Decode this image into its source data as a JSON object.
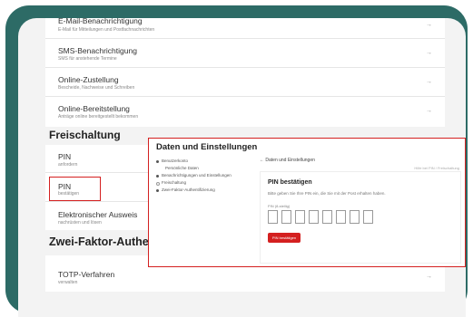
{
  "top_rows": [
    {
      "title": "E-Mail-Benachrichtigung",
      "subtitle": "E-Mail für Mitteilungen und Postfachnachrichten"
    },
    {
      "title": "SMS-Benachrichtigung",
      "subtitle": "SMS für anstehende Termine"
    },
    {
      "title": "Online-Zustellung",
      "subtitle": "Bescheide, Nachweise und Schreiben"
    },
    {
      "title": "Online-Bereitstellung",
      "subtitle": "Anträge online bereitgestellt bekommen"
    }
  ],
  "freischaltung": {
    "heading": "Freischaltung",
    "rows": [
      {
        "title": "PIN",
        "subtitle": "anfordern"
      },
      {
        "title": "PIN",
        "subtitle": "bestätigen"
      },
      {
        "title": "Elektronischer Ausweis",
        "subtitle": "nachrüsten und lösen"
      }
    ]
  },
  "zwei_faktor": {
    "heading": "Zwei-Faktor-Authentifizierung",
    "rows": [
      {
        "title": "TOTP-Verfahren",
        "subtitle": "verwalten"
      }
    ]
  },
  "arrow_glyph": "→",
  "overlay": {
    "title": "Daten und Einstellungen",
    "sidebar": [
      {
        "label": "Benutzerkonto",
        "marker": "dot"
      },
      {
        "label": "Persönliche Daten",
        "marker": "none"
      },
      {
        "label": "Benachrichtigungen und Einstellungen",
        "marker": "dot"
      },
      {
        "label": "Freischaltung",
        "marker": "ring"
      },
      {
        "label": "Zwei-Faktor-Authentifizierung",
        "marker": "dot"
      }
    ],
    "back_link": "← Daten und Einstellungen",
    "right_link": "Hilfe bei PIN / Freischaltung",
    "pin_title": "PIN bestätigen",
    "pin_desc": "Bitte geben Sie Ihre PIN ein, die Sie mit der Post erhalten haben.",
    "pin_label": "PIN (8-stellig)",
    "pin_box_count": 8,
    "button_label": "PIN bestätigen"
  }
}
